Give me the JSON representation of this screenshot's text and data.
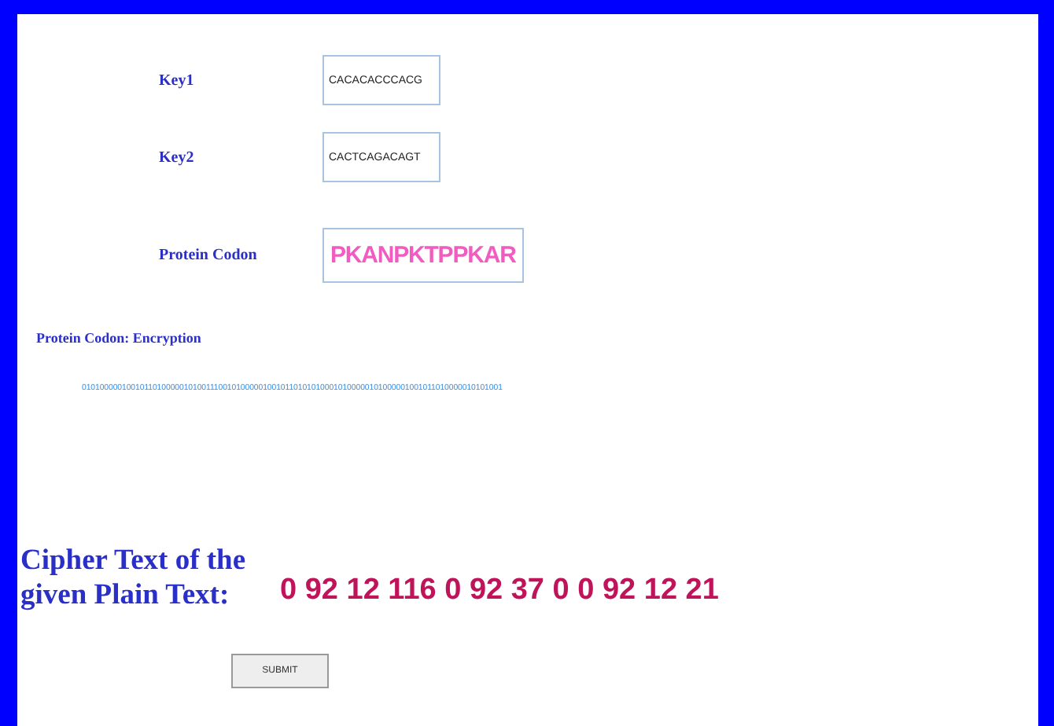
{
  "fields": [
    {
      "label": "Key1",
      "value": "CACACACCCACG",
      "kind": "small"
    },
    {
      "label": "Key2",
      "value": "CACTCAGACAGT",
      "kind": "small"
    },
    {
      "label": "Protein Codon",
      "value": "PKANPKTPPKAR",
      "kind": "large"
    }
  ],
  "encryption": {
    "heading": "Protein Codon: Encryption",
    "bits": "01010000010010110100000101001110010100000100101101010100010100000101000001001011010000010101001"
  },
  "cipher": {
    "heading": "Cipher Text of the given Plain Text:",
    "value": "0 92 12 116 0 92 37 0 0 92 12 21"
  },
  "buttons": [
    "SUBMIT"
  ]
}
